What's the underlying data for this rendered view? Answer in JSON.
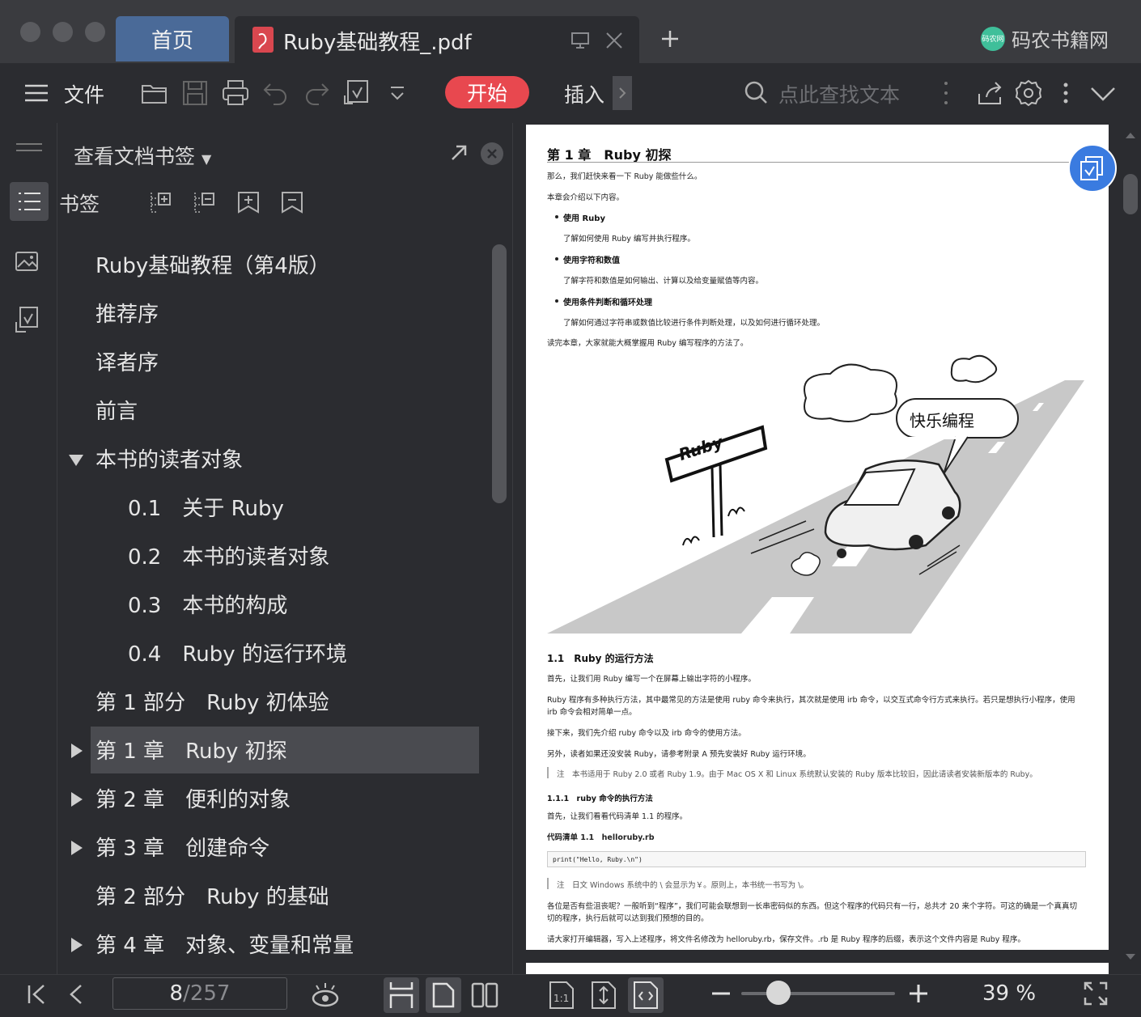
{
  "titlebar": {
    "home_tab": "首页",
    "doc_tab": "Ruby基础教程_.pdf",
    "brand": "码农书籍网",
    "brand_logo_text": "码农网"
  },
  "toolbar": {
    "file_label": "文件",
    "start_label": "开始",
    "insert_label": "插入",
    "search_placeholder": "点此查找文本"
  },
  "panel": {
    "title": "查看文档书签",
    "bookmarks_label": "书签",
    "tree": [
      {
        "text": "Ruby基础教程（第4版）",
        "level": 0,
        "arrow": "none"
      },
      {
        "text": "推荐序",
        "level": 0,
        "arrow": "none"
      },
      {
        "text": "译者序",
        "level": 0,
        "arrow": "none"
      },
      {
        "text": "前言",
        "level": 0,
        "arrow": "none"
      },
      {
        "text": "本书的读者对象",
        "level": 0,
        "arrow": "down"
      },
      {
        "text": "0.1　关于 Ruby",
        "level": 1,
        "arrow": "none"
      },
      {
        "text": "0.2　本书的读者对象",
        "level": 1,
        "arrow": "none"
      },
      {
        "text": "0.3　本书的构成",
        "level": 1,
        "arrow": "none"
      },
      {
        "text": "0.4　Ruby 的运行环境",
        "level": 1,
        "arrow": "none"
      },
      {
        "text": "第 1 部分　Ruby 初体验",
        "level": 0,
        "arrow": "none"
      },
      {
        "text": "第 1 章　Ruby 初探",
        "level": 0,
        "arrow": "right",
        "selected": true
      },
      {
        "text": "第 2 章　便利的对象",
        "level": 0,
        "arrow": "right"
      },
      {
        "text": "第 3 章　创建命令",
        "level": 0,
        "arrow": "right"
      },
      {
        "text": "第 2 部分　Ruby 的基础",
        "level": 0,
        "arrow": "none"
      },
      {
        "text": "第 4 章　对象、变量和常量",
        "level": 0,
        "arrow": "right"
      }
    ]
  },
  "document": {
    "chapter_title": "第 1 章　Ruby 初探",
    "intro1": "那么，我们赶快来看一下 Ruby 能做些什么。",
    "intro2": "本章会介绍以下内容。",
    "b1_title": "使用 Ruby",
    "b1_text": "了解如何使用 Ruby 编写并执行程序。",
    "b2_title": "使用字符和数值",
    "b2_text": "了解字符和数值是如何输出、计算以及给变量赋值等内容。",
    "b3_title": "使用条件判断和循环处理",
    "b3_text": "了解如何通过字符串或数值比较进行条件判断处理，以及如何进行循环处理。",
    "outro": "读完本章，大家就能大概掌握用 Ruby 编写程序的方法了。",
    "illus_sign": "Ruby",
    "illus_bubble": "快乐编程",
    "s11_title": "1.1　Ruby 的运行方法",
    "s11_p1": "首先，让我们用 Ruby 编写一个在屏幕上输出字符的小程序。",
    "s11_p2a": "Ruby 程序有多种执行方法，其中最常见的方法是使用 ruby 命令来执行，其次就是使用 irb 命令，以交互式命令行方式来执行。若只是想执行小程序，使用",
    "s11_p2b": "irb 命令会相对简单一点。",
    "s11_p3": "接下来，我们先介绍 ruby 命令以及 irb 命令的使用方法。",
    "s11_p4": "另外，读者如果还没安装 Ruby，请参考附录 A 预先安装好 Ruby 运行环境。",
    "note1": "注　本书适用于 Ruby 2.0 或者 Ruby 1.9。由于 Mac OS X 和 Linux 系统默认安装的 Ruby 版本比较旧，因此请读者安装新版本的 Ruby。",
    "s111_title": "1.1.1　ruby 命令的执行方法",
    "s111_p1": "首先，让我们看看代码清单 1.1 的程序。",
    "listing": "代码清单 1.1　helloruby.rb",
    "code": "print(\"Hello, Ruby.\\n\")",
    "note2": "注　日文 Windows 系统中的 \\ 会显示为￥。原则上，本书统一书写为 \\。",
    "p5a": "各位是否有些沮丧呢？一般听到“程序”，我们可能会联想到一长串密码似的东西。但这个程序的代码只有一行，总共才 20 来个字符。可这的确是一个真真切",
    "p5b": "切的程序，执行后就可以达到我们预想的目的。",
    "p6": "请大家打开编辑器，写入上述程序，将文件名修改为 helloruby.rb，保存文件。.rb 是 Ruby 程序的后缀，表示这个文件内容是 Ruby 程序。"
  },
  "statusbar": {
    "current_page": "8",
    "total_pages": "/257",
    "zoom": "39 %",
    "zoom_fraction": 0.24
  }
}
